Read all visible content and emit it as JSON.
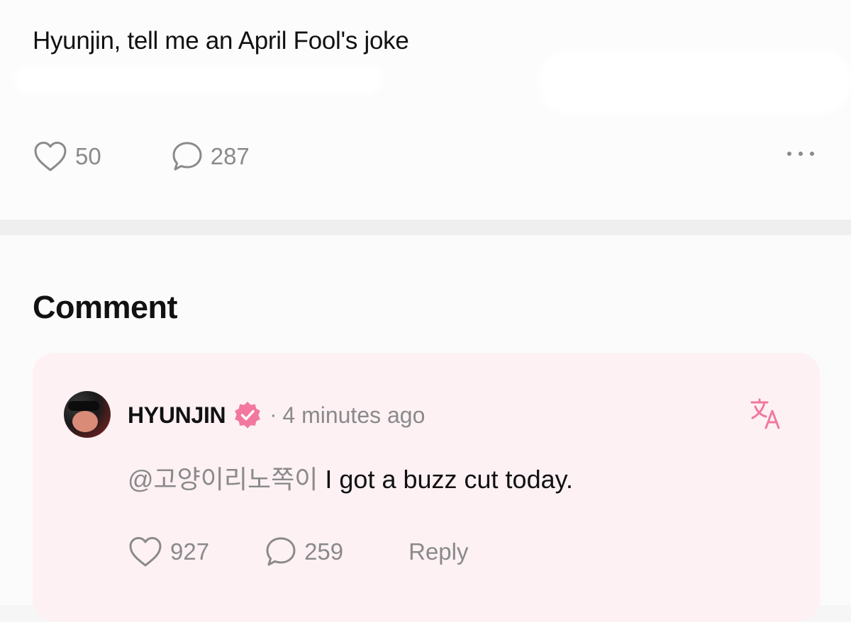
{
  "post": {
    "text": "Hyunjin, tell me an April Fool's joke",
    "likes": "50",
    "comments": "287",
    "icons": [
      "heart-icon",
      "speech-bubble-icon",
      "more-icon"
    ]
  },
  "comments_section": {
    "heading": "Comment",
    "comment": {
      "author": "HYUNJIN",
      "separator": "·",
      "time": "4 minutes ago",
      "mention": "@고양이리노쪽이",
      "text": "I got a buzz cut today.",
      "likes": "927",
      "replies_count": "259",
      "reply_label": "Reply",
      "accent_color": "#f2789f",
      "icons": [
        "verified-badge-icon",
        "translate-icon",
        "heart-icon",
        "speech-bubble-icon"
      ]
    }
  }
}
